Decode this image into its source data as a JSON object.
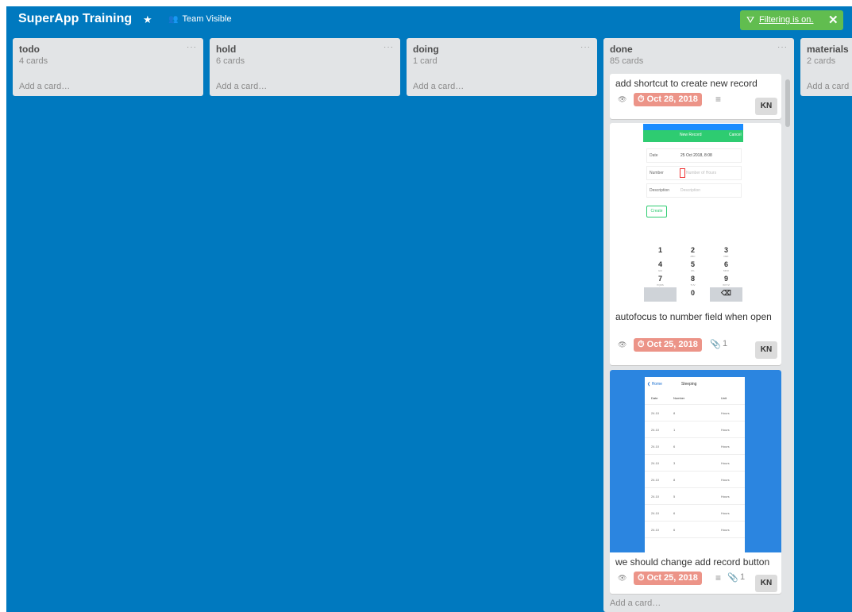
{
  "header": {
    "board_title": "SuperApp Training",
    "star_icon": "★",
    "visibility": "Team Visible",
    "filter": {
      "label": "Filtering is on.",
      "close": "✕"
    }
  },
  "lists": [
    {
      "name": "todo",
      "count": "4 cards",
      "add": "Add a card…"
    },
    {
      "name": "hold",
      "count": "6 cards",
      "add": "Add a card…"
    },
    {
      "name": "doing",
      "count": "1 card",
      "add": "Add a card…"
    },
    {
      "name": "done",
      "count": "85 cards",
      "add": "Add a card…"
    },
    {
      "name": "materials",
      "count": "2 cards",
      "add": "Add a card"
    }
  ],
  "list_menu": "···",
  "cards": [
    {
      "title": "add shortcut to create new record",
      "due": "Oct 28, 2018",
      "member": "KN",
      "has_description": true
    },
    {
      "title": "autofocus to number field when open",
      "due": "Oct 25, 2018",
      "attachments": "1",
      "member": "KN"
    },
    {
      "title": "we should change add record button",
      "due": "Oct 25, 2018",
      "attachments": "1",
      "member": "KN",
      "has_description": true
    }
  ],
  "icons": {
    "watch": "watch-eye-icon",
    "clock": "clock-icon",
    "description": "description-icon",
    "attachment": "paperclip-icon",
    "filter": "filter-funnel-icon",
    "team": "team-people-icon"
  },
  "glyphs": {
    "eye": "👁",
    "clock": "⏱",
    "desc": "≡",
    "clip": "📎",
    "funnel": "⛛",
    "people": "👥"
  },
  "new_record_screen": {
    "title": "New Record",
    "cancel": "Cancel",
    "date_label": "Date",
    "date_value": "25 Oct 2018, 8:08",
    "number_label": "Number",
    "number_placeholder": "Number of Hours",
    "description_label": "Description",
    "description_placeholder": "Description",
    "create": "Create",
    "keys": [
      {
        "d": "1",
        "l": ""
      },
      {
        "d": "2",
        "l": "ABC"
      },
      {
        "d": "3",
        "l": "DEF"
      },
      {
        "d": "4",
        "l": "GHI"
      },
      {
        "d": "5",
        "l": "JKL"
      },
      {
        "d": "6",
        "l": "MNO"
      },
      {
        "d": "7",
        "l": "PQRS"
      },
      {
        "d": "8",
        "l": "TUV"
      },
      {
        "d": "9",
        "l": "WXYZ"
      },
      {
        "d": "",
        "l": ""
      },
      {
        "d": "0",
        "l": ""
      },
      {
        "d": "⌫",
        "l": ""
      }
    ]
  },
  "sleeping_screen": {
    "back": "❮ Home",
    "title": "Sleeping",
    "columns": [
      "Date",
      "Number",
      "Unit"
    ],
    "rows": [
      [
        "24.10",
        "8",
        "Hours"
      ],
      [
        "24.10",
        "1",
        "Hours"
      ],
      [
        "24.10",
        "6",
        "Hours"
      ],
      [
        "24.10",
        "3",
        "Hours"
      ],
      [
        "24.10",
        "8",
        "Hours"
      ],
      [
        "24.10",
        "5",
        "Hours"
      ],
      [
        "24.10",
        "6",
        "Hours"
      ],
      [
        "24.10",
        "6",
        "Hours"
      ]
    ]
  },
  "colors": {
    "board": "#0079bf",
    "list": "#e2e4e6",
    "due_overdue": "#ec9488",
    "filter": "#61bd4f"
  }
}
